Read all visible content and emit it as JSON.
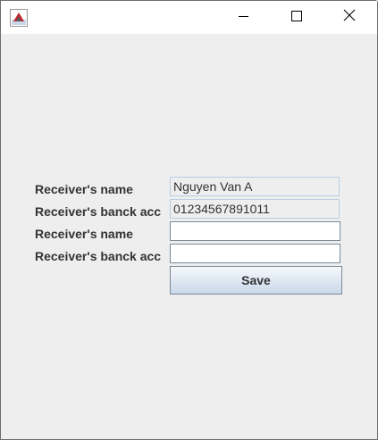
{
  "window": {
    "icon": "java-app-icon",
    "controls": {
      "minimize_icon": "minimize-icon",
      "maximize_icon": "maximize-icon",
      "close_icon": "close-icon"
    }
  },
  "form": {
    "rows": [
      {
        "label": "Receiver's name",
        "value": "Nguyen Van A",
        "editable": false
      },
      {
        "label": "Receiver's banck acc",
        "value": "01234567891011",
        "editable": false
      },
      {
        "label": "Receiver's name",
        "value": "",
        "editable": true
      },
      {
        "label": "Receiver's banck acc",
        "value": "",
        "editable": true
      }
    ],
    "save_label": "Save"
  },
  "colors": {
    "window_bg": "#eeeeee",
    "titlebar_bg": "#ffffff",
    "readonly_border": "#b8cfe5",
    "editable_border": "#7a8a99"
  }
}
